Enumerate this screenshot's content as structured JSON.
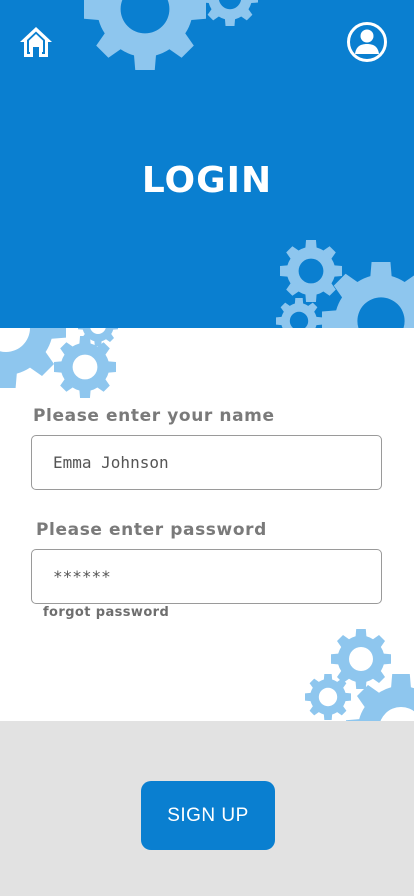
{
  "header": {
    "title": "LOGIN",
    "home_icon": "home-icon",
    "profile_icon": "profile-icon",
    "background_color": "#0a7fd0",
    "gear_color": "#8ec6ee"
  },
  "form": {
    "name_label": "Please enter your name",
    "name_value": "Emma Johnson",
    "password_label": "Please enter password",
    "password_value": "******",
    "forgot_label": "forgot password"
  },
  "footer": {
    "signup_label": "SIGN UP",
    "background_color": "#e2e2e2",
    "button_color": "#0a7fd0"
  }
}
